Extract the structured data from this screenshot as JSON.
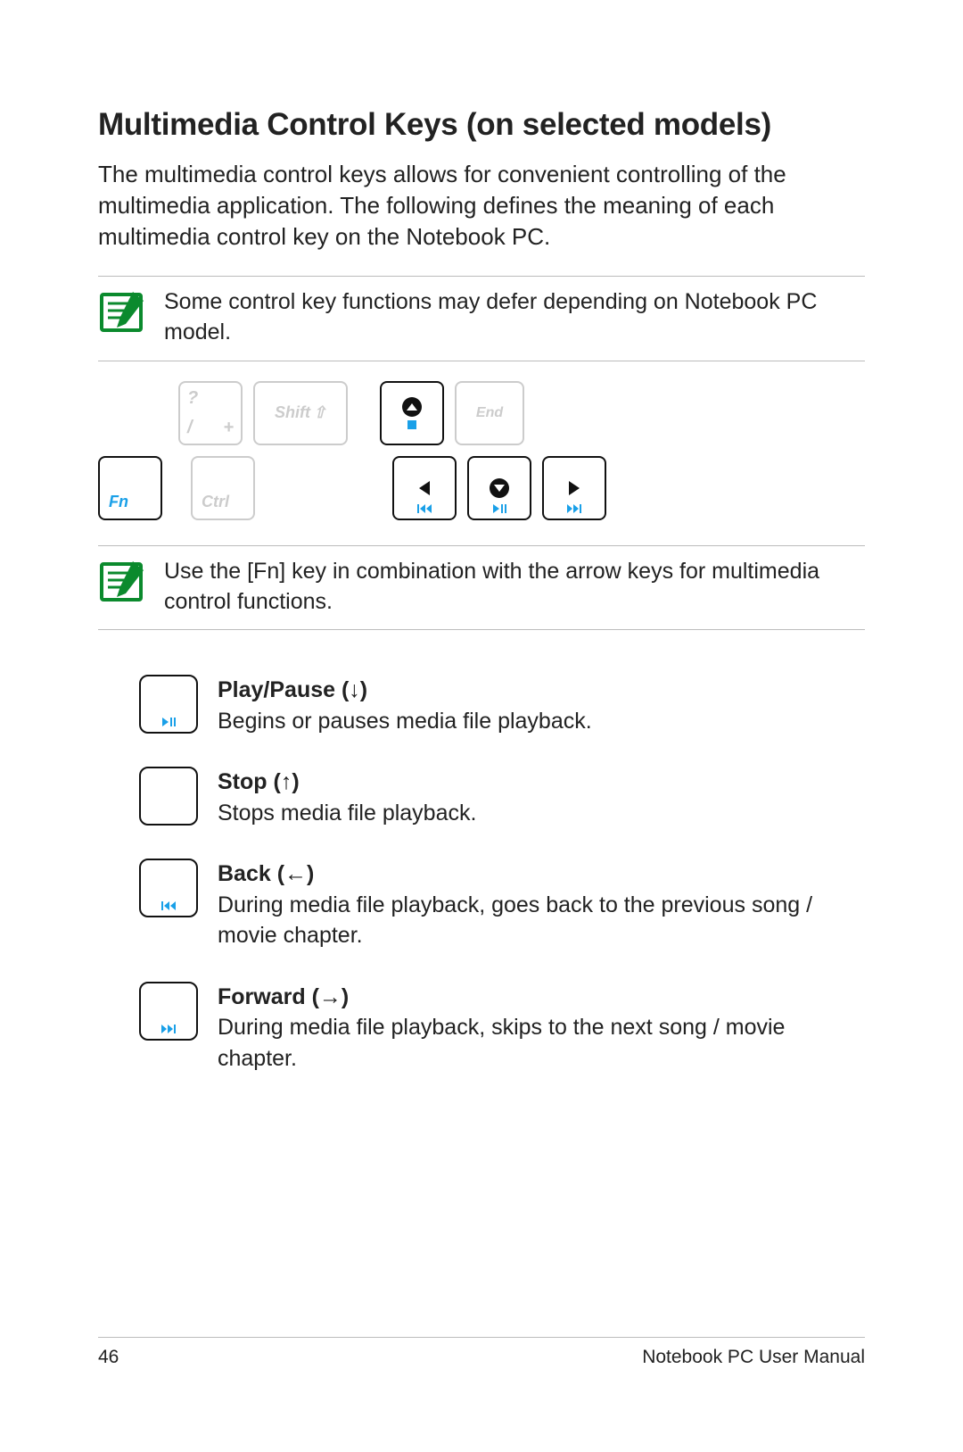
{
  "heading": "Multimedia Control Keys (on selected models)",
  "intro": "The multimedia control keys allows for convenient controlling of the multimedia application. The following defines the meaning of each multimedia control key on the Notebook PC.",
  "note1": "Some control key functions may defer depending on Notebook PC model.",
  "note2": "Use the [Fn] key in combination with the arrow keys for multimedia control functions.",
  "keys": {
    "slash_top": "?",
    "slash_bottom_left": "/",
    "slash_bottom_right": "+",
    "shift": "Shift",
    "end": "End",
    "fn": "Fn",
    "ctrl": "Ctrl"
  },
  "defs": [
    {
      "title": "Play/Pause (↓)",
      "body": "Begins or pauses media file playback."
    },
    {
      "title": "Stop (↑)",
      "body": "Stops media file playback."
    },
    {
      "title": "Back (←)",
      "body": "During media file playback, goes back to the previous song / movie chapter."
    },
    {
      "title": "Forward (→)",
      "body": "During media file playback, skips to the next song / movie chapter."
    }
  ],
  "footer": {
    "page": "46",
    "title": "Notebook PC User Manual"
  }
}
